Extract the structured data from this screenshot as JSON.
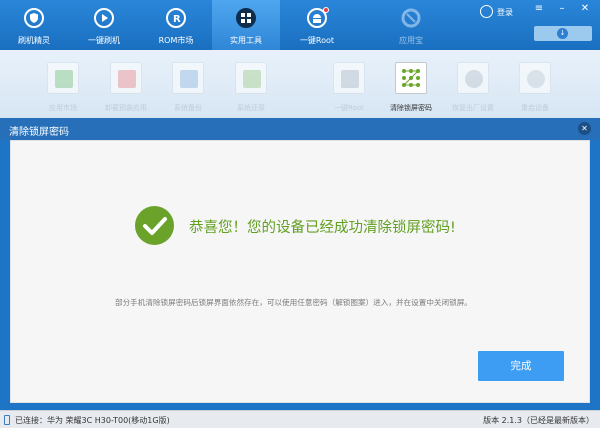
{
  "nav": {
    "items": [
      {
        "label": "刷机精灵",
        "icon": "shield-icon"
      },
      {
        "label": "一键刷机",
        "icon": "play-icon"
      },
      {
        "label": "ROM市场",
        "icon": "rom-icon"
      },
      {
        "label": "实用工具",
        "icon": "grid-icon"
      },
      {
        "label": "一键Root",
        "icon": "android-icon"
      },
      {
        "label": "应用宝",
        "icon": "app-store-icon"
      }
    ],
    "active": "实用工具",
    "login_label": "登录"
  },
  "tools": {
    "items": [
      {
        "label": "应用市场"
      },
      {
        "label": "卸载预装应用"
      },
      {
        "label": "系统备份"
      },
      {
        "label": "系统还原"
      },
      {
        "label": "一键Root"
      },
      {
        "label": "清除锁屏密码"
      },
      {
        "label": "恢复出厂设置"
      },
      {
        "label": "重启设备"
      }
    ],
    "selected": "清除锁屏密码"
  },
  "dialog": {
    "title": "清除锁屏密码",
    "headline": "恭喜您！您的设备已经成功清除锁屏密码!",
    "note": "部分手机清除锁屏密码后锁屏界面依然存在，可以使用任意密码（解锁图案）进入，并在设置中关闭锁屏。",
    "done_label": "完成"
  },
  "status": {
    "connection": "已连接：华为 荣耀3C H30-T00(移动1G版)",
    "version": "版本 2.1.3（已经是最新版本）"
  },
  "colors": {
    "primary": "#2a86d9",
    "success": "#62a021",
    "button": "#3d9df3"
  }
}
